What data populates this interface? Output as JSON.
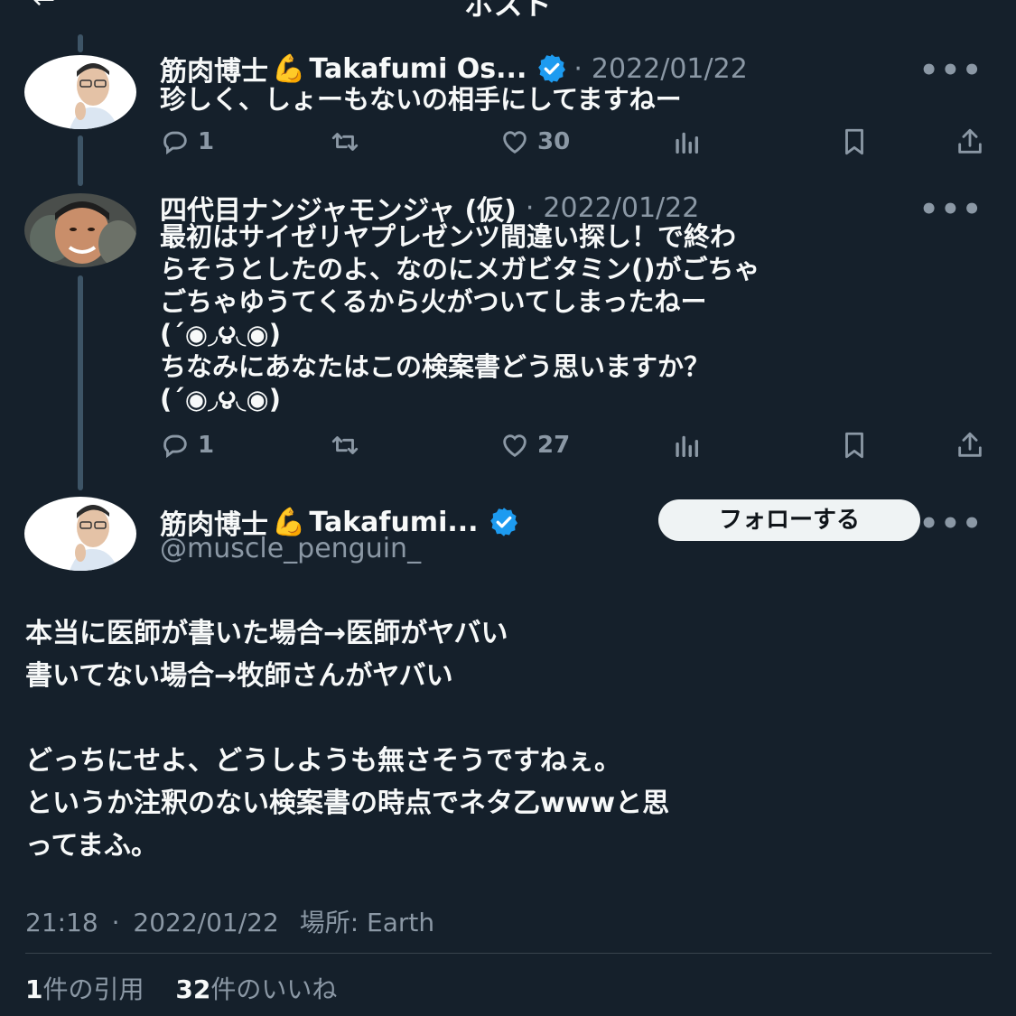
{
  "header": {
    "title": "ポスト",
    "back_icon": "←"
  },
  "tweets": [
    {
      "name": "筋肉博士",
      "emoji": "💪",
      "name_suffix": "Takafumi Os...",
      "separator": "·",
      "date": "2022/01/22",
      "text": "珍しく、しょーもないの相手にしてますねー",
      "replies": "1",
      "likes": "30"
    },
    {
      "name": "四代目ナンジャモンジャ (仮)",
      "separator": "·",
      "date": "2022/01/22",
      "text": "最初はサイゼリヤプレゼンツ間違い探し！で終わ\nらそうとしたのよ、なのにメガビタミン()がごちゃ\nごちゃゆうてくるから火がついてしまったねー\n(´◉◞౪◟◉)\nちなみにあなたはこの検案書どう思いますか？\n(´◉◞౪◟◉)",
      "replies": "1",
      "likes": "27"
    }
  ],
  "main": {
    "name": "筋肉博士",
    "emoji": "💪",
    "name_suffix": "Takafumi...",
    "handle": "@muscle_penguin_",
    "follow_label": "フォローする",
    "text": "本当に医師が書いた場合→医師がヤバい\n書いてない場合→牧師さんがヤバい\n\nどっちにせよ、どうしようも無さそうですねぇ。\nというか注釈のない検案書の時点でネタ乙wwwと思\nってまふ。",
    "time": "21:18",
    "separator": "·",
    "date": "2022/01/22",
    "location_label": "場所: Earth",
    "quotes_count": "1",
    "quotes_label": "件の引用",
    "likes_count": "32",
    "likes_label": "件のいいね"
  },
  "more_label": "•••",
  "colors": {
    "background": "#15202b",
    "text": "#f7f9f9",
    "muted": "#8b98a5",
    "verified": "#1d9bf0"
  }
}
